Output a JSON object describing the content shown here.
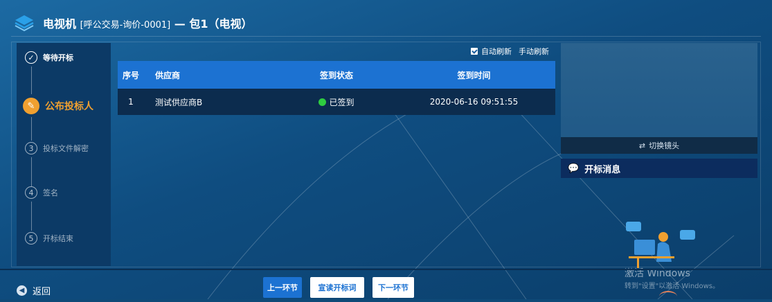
{
  "header": {
    "title_main": "电视机",
    "title_code": "[呼公交易-询价-0001]",
    "title_sep": "—",
    "title_pack": "包1（电视）"
  },
  "steps": [
    {
      "num": "✓",
      "label": "等待开标",
      "state": "done"
    },
    {
      "num": "✎",
      "label": "公布投标人",
      "state": "active"
    },
    {
      "num": "3",
      "label": "投标文件解密",
      "state": "pending"
    },
    {
      "num": "4",
      "label": "签名",
      "state": "pending"
    },
    {
      "num": "5",
      "label": "开标结束",
      "state": "pending"
    }
  ],
  "toolbar": {
    "auto_refresh": "自动刷新",
    "auto_refresh_checked": true,
    "manual_refresh": "手动刷新"
  },
  "table": {
    "headers": [
      "序号",
      "供应商",
      "签到状态",
      "签到时间"
    ],
    "rows": [
      {
        "seq": "1",
        "supplier": "测试供应商B",
        "status": "已签到",
        "time": "2020-06-16 09:51:55"
      }
    ]
  },
  "video": {
    "switch_label": "切换镜头"
  },
  "messages": {
    "title": "开标消息"
  },
  "footer": {
    "back_label": "返回",
    "prev_label": "上一环节",
    "announce_label": "宣读开标词",
    "next_label": "下一环节"
  },
  "watermark": {
    "line1": "激活 Windows",
    "line2": "转到\"设置\"以激活 Windows。"
  },
  "colors": {
    "accent": "#1c72d2",
    "active_step": "#f0a030",
    "signed": "#2ecc40"
  }
}
